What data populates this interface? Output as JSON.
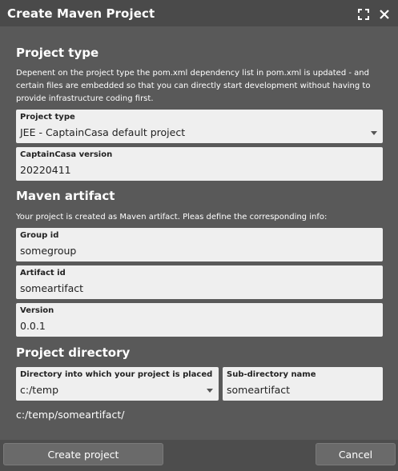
{
  "window": {
    "title": "Create Maven Project"
  },
  "project_type": {
    "heading": "Project type",
    "description": "Depenent on the project type the pom.xml dependency list in pom.xml is updated - and certain files are embedded so that you can directly start development without having to provide infrastructure coding first.",
    "type_field": {
      "label": "Project type",
      "value": "JEE - CaptainCasa default project"
    },
    "version_field": {
      "label": "CaptainCasa version",
      "value": "20220411"
    }
  },
  "maven_artifact": {
    "heading": "Maven artifact",
    "description": "Your project is created as Maven artifact. Pleas define the corresponding info:",
    "group_id": {
      "label": "Group id",
      "value": "somegroup"
    },
    "artifact_id": {
      "label": "Artifact id",
      "value": "someartifact"
    },
    "version": {
      "label": "Version",
      "value": "0.0.1"
    }
  },
  "project_directory": {
    "heading": "Project directory",
    "directory": {
      "label": "Directory into which your project is placed",
      "value": "c:/temp"
    },
    "subdirectory": {
      "label": "Sub-directory name",
      "value": "someartifact"
    },
    "full_path": "c:/temp/someartifact/"
  },
  "footer": {
    "create_label": "Create project",
    "cancel_label": "Cancel"
  }
}
